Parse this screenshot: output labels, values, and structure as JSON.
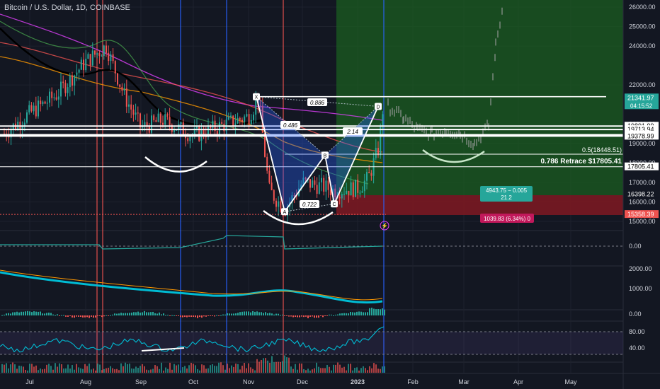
{
  "header": {
    "title": "Bitcoin / U.S. Dollar, 1D, COINBASE"
  },
  "colors": {
    "bg": "#131722",
    "grid": "#1e222d",
    "up": "#26a69a",
    "down": "#ef5350",
    "pattern": "#2962ff",
    "target_zone": "#1b5e20",
    "stop_zone": "#801922",
    "white": "#ffffff",
    "axis_text": "#d1d4dc"
  },
  "chart_data": [
    {
      "type": "candlestick",
      "title": "Bitcoin / U.S. Dollar, 1D, COINBASE",
      "x_ticks": [
        "Jul",
        "Aug",
        "Sep",
        "Oct",
        "Nov",
        "Dec",
        "2023",
        "Feb",
        "Mar",
        "Apr",
        "May"
      ],
      "y_ticks": [
        15000,
        16000,
        17000,
        18000,
        19000,
        20000,
        22000,
        24000,
        25000,
        26000
      ],
      "y_tick_labels": [
        "15000.00",
        "16000.00",
        "17000.00",
        "18000.00",
        "19000.00",
        "20000.00",
        "22000.00",
        "24000.00",
        "25000.00",
        "26000.00"
      ],
      "ylim": [
        14600,
        26400
      ],
      "series_close_approx": [
        {
          "month": "Jul",
          "value": 20500
        },
        {
          "month": "Aug",
          "value": 23200
        },
        {
          "month": "Sep",
          "value": 19800
        },
        {
          "month": "Oct",
          "value": 19400
        },
        {
          "month": "Nov",
          "value": 20400
        },
        {
          "month": "Nov",
          "value": 16500
        },
        {
          "month": "Dec",
          "value": 16900
        },
        {
          "month": "2023",
          "value": 16600
        },
        {
          "month": "2023",
          "value": 21342
        }
      ],
      "price_labels": [
        {
          "value": 21341.97,
          "text": "21341.97",
          "sub": "04:15:52",
          "color": "#26a69a"
        },
        {
          "value": 19891.99,
          "text": "19891.99",
          "color": "#ffffff"
        },
        {
          "value": 19713.94,
          "text": "19713.94",
          "color": "#ffffff"
        },
        {
          "value": 19448.64,
          "text": "19448.64",
          "color": "#ffffff"
        },
        {
          "value": 19378.99,
          "text": "19378.99",
          "color": "#ffffff"
        },
        {
          "value": 17805.41,
          "text": "17805.41",
          "color": "#ffffff"
        },
        {
          "value": 16398.22,
          "text": "16398.22",
          "color": "#131722"
        },
        {
          "value": 15358.39,
          "text": "15358.39",
          "color": "#ef5350"
        }
      ],
      "harmonic_points": [
        {
          "label": "X",
          "month": "Nov",
          "value": 21400
        },
        {
          "label": "A",
          "month": "Nov",
          "value": 15500
        },
        {
          "label": "B",
          "month": "Dec",
          "value": 18400
        },
        {
          "label": "C",
          "month": "Dec",
          "value": 15900
        },
        {
          "label": "D",
          "month": "2023",
          "value": 20900
        }
      ],
      "ratios": [
        "0.886",
        "0.486",
        "2.14",
        "0.722"
      ],
      "annotations": {
        "fib_half": "0.5(18448.51)",
        "retrace": "0.786 Retrace $17805.41",
        "target_box": "4943.75 − 0.005",
        "target_box_sub": "21.2",
        "stop_box": "1039.83 (6.34%) 0"
      },
      "projection_peak": 26000
    },
    {
      "type": "line",
      "name": "indicator-1",
      "y_ticks": [
        "0.00"
      ]
    },
    {
      "type": "line",
      "name": "indicator-2",
      "y_ticks": [
        "2000.00",
        "1000.00"
      ]
    },
    {
      "type": "bar",
      "name": "indicator-3",
      "y_ticks": [
        "0.00"
      ]
    },
    {
      "type": "line",
      "name": "rsi",
      "y_ticks": [
        "80.00",
        "40.00"
      ]
    }
  ]
}
